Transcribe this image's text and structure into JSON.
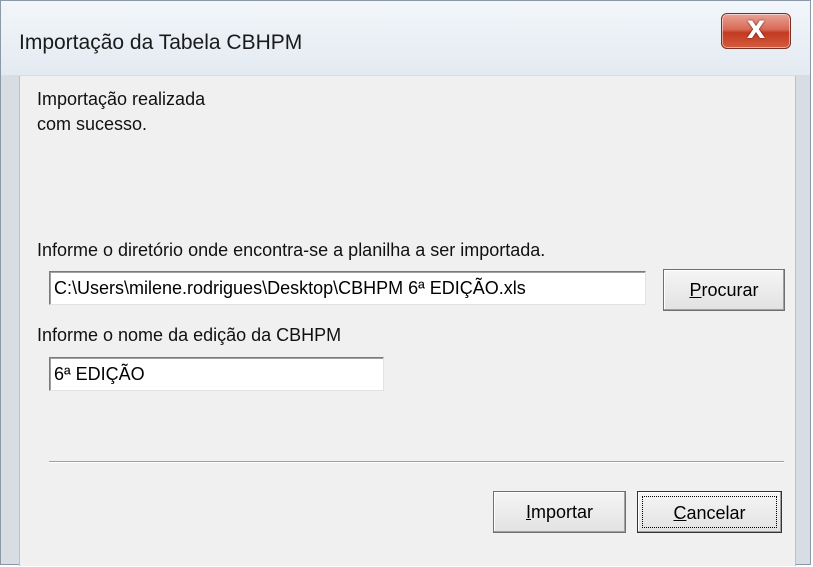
{
  "window": {
    "title": "Importação da Tabela CBHPM",
    "close_glyph": "X"
  },
  "message": {
    "line1": "Importação realizada",
    "line2": "com sucesso."
  },
  "directory": {
    "label": "Informe o diretório onde encontra-se a planilha a ser importada.",
    "value": "C:\\Users\\milene.rodrigues\\Desktop\\CBHPM 6ª EDIÇÃO.xls",
    "browse_accel": "P",
    "browse_rest": "rocurar"
  },
  "edition": {
    "label": "Informe o nome da edição da CBHPM",
    "value": "6ª EDIÇÃO"
  },
  "buttons": {
    "import_accel": "I",
    "import_rest": "mportar",
    "cancel_accel": "C",
    "cancel_rest": "ancelar"
  }
}
